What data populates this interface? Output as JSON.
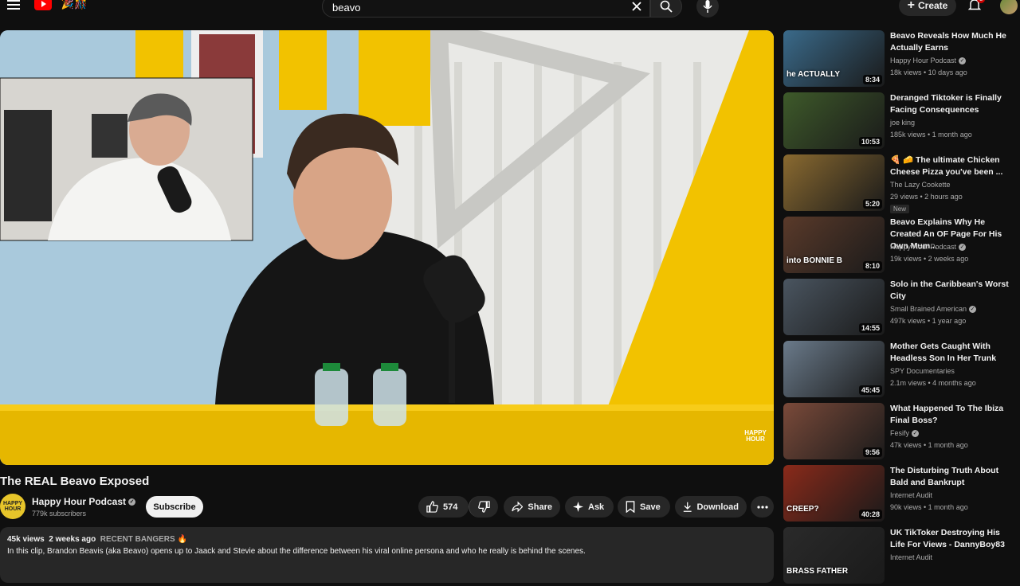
{
  "header": {
    "search_value": "beavo",
    "create_label": "Create",
    "notification_count": "3"
  },
  "video": {
    "title": "The REAL Beavo Exposed",
    "overlay_brand": "HAPPY HOUR"
  },
  "channel": {
    "name": "Happy Hour Podcast",
    "subscribers": "779k subscribers",
    "subscribe_label": "Subscribe",
    "avatar_text": "HAPPY HOUR"
  },
  "actions": {
    "like_count": "574",
    "share_label": "Share",
    "ask_label": "Ask",
    "save_label": "Save",
    "download_label": "Download"
  },
  "description": {
    "views": "45k views",
    "age": "2 weeks ago",
    "tag": "RECENT BANGERS 🔥",
    "text": "In this clip, Brandon Beavis (aka Beavo) opens up to Jaack and Stevie about the difference between his viral online persona and who he really is behind the scenes."
  },
  "recommendations": [
    {
      "title": "Beavo Reveals How Much He Actually Earns",
      "channel": "Happy Hour Podcast",
      "verified": true,
      "stats": "18k views • 10 days ago",
      "duration": "8:34",
      "thumb_text": "he ACTUALLY",
      "thumb_color": "#3a6a8a"
    },
    {
      "title": "Deranged Tiktoker is Finally Facing Consequences",
      "channel": "joe king",
      "verified": false,
      "stats": "185k views • 1 month ago",
      "duration": "10:53",
      "thumb_text": "",
      "thumb_color": "#3e5a2a"
    },
    {
      "title": "🍕 🧀 The ultimate Chicken Cheese Pizza you've been ...",
      "channel": "The Lazy Cookette",
      "verified": false,
      "stats": "29 views • 2 hours ago",
      "duration": "5:20",
      "badge": "New",
      "thumb_text": "",
      "thumb_color": "#8a6a30"
    },
    {
      "title": "Beavo Explains Why He Created An OF Page For His Own Mum...",
      "channel": "Happy Hour Podcast",
      "verified": true,
      "stats": "19k views • 2 weeks ago",
      "duration": "8:10",
      "thumb_text": "into BONNIE B",
      "thumb_color": "#5a3a2a"
    },
    {
      "title": "Solo in the Caribbean's Worst City",
      "channel": "Small Brained American",
      "verified": true,
      "stats": "497k views • 1 year ago",
      "duration": "14:55",
      "thumb_text": "",
      "thumb_color": "#4a5560"
    },
    {
      "title": "Mother Gets Caught With Headless Son In Her Trunk",
      "channel": "SPY Documentaries",
      "verified": false,
      "stats": "2.1m views • 4 months ago",
      "duration": "45:45",
      "thumb_text": "",
      "thumb_color": "#6a7a8a"
    },
    {
      "title": "What Happened To The Ibiza Final Boss?",
      "channel": "Fesify",
      "verified": true,
      "stats": "47k views • 1 month ago",
      "duration": "9:56",
      "thumb_text": "",
      "thumb_color": "#7a4a3a"
    },
    {
      "title": "The Disturbing Truth About Bald and Bankrupt",
      "channel": "Internet Audit",
      "verified": false,
      "stats": "90k views • 1 month ago",
      "duration": "40:28",
      "thumb_text": "CREEP?",
      "thumb_color": "#8a2a1a"
    },
    {
      "title": "UK TikToker Destroying His Life For Views - DannyBoy83",
      "channel": "Internet Audit",
      "verified": false,
      "stats": "",
      "duration": "",
      "thumb_text": "BRASS FATHER",
      "thumb_color": "#2a2a2a"
    }
  ],
  "colors": {
    "background": "#0f0f0f",
    "pill": "#272727",
    "youtube_red": "#ff0000",
    "set_yellow": "#f2c200"
  }
}
